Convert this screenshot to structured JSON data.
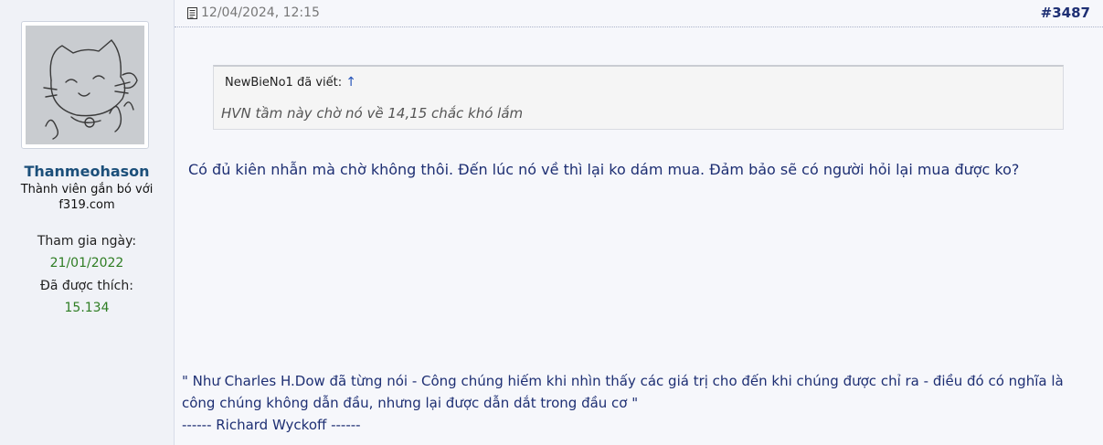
{
  "user": {
    "name": "Thanmeohason",
    "title": "Thành viên gắn bó với f319.com",
    "joined_label": "Tham gia ngày:",
    "joined_value": "21/01/2022",
    "likes_label": "Đã được thích:",
    "likes_value": "15.134"
  },
  "post": {
    "date": "12/04/2024, 12:15",
    "number": "#3487",
    "date_icon": "document-icon"
  },
  "quote": {
    "author_text": "NewBieNo1 đã viết:",
    "arrow": "↑",
    "text": "HVN tầm này chờ nó về 14,15 chắc khó lắm"
  },
  "message": "Có đủ kiên nhẫn mà chờ không thôi. Đến lúc nó về thì lại ko dám mua. Đảm bảo sẽ có người hỏi lại mua được ko?",
  "signature": {
    "line1": "\" Như Charles H.Dow đã từng nói - Công chúng hiếm khi nhìn thấy các giá trị cho đến khi chúng được chỉ ra - điều đó có nghĩa là công chúng không dẫn đầu, nhưng lại được dẫn dắt trong đầu cơ \"",
    "line2": "------ Richard Wyckoff ------"
  },
  "colors": {
    "username": "#1b4f7a",
    "stat_value": "#2e7d23",
    "post_text": "#1e2f73",
    "sidebar_bg": "#f0f2f7",
    "main_bg": "#f6f7fb"
  }
}
